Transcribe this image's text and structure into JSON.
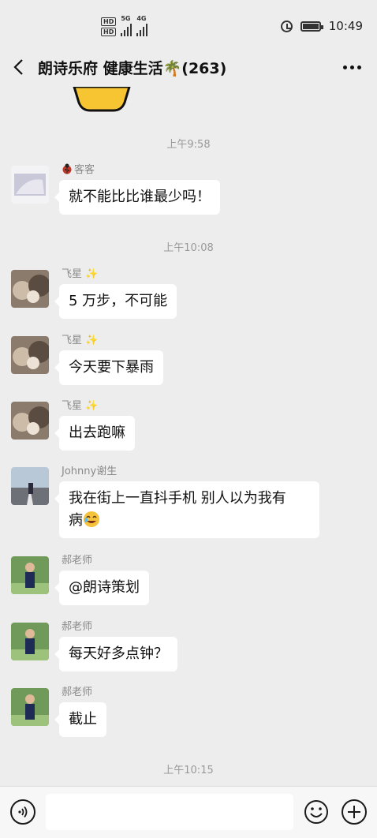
{
  "status_bar": {
    "hd1": "HD",
    "hd2": "HD",
    "net1": "5G",
    "net2": "4G",
    "time": "10:49"
  },
  "header": {
    "title": "朗诗乐府 健康生活🌴(263)"
  },
  "chat": {
    "timestamps": [
      "上午9:58",
      "上午10:08",
      "上午10:15"
    ],
    "messages": [
      {
        "sender": "客客",
        "text": "就不能比比谁最少吗！"
      },
      {
        "sender": "飞星",
        "text": "5 万步，不可能"
      },
      {
        "sender": "飞星",
        "text": "今天要下暴雨"
      },
      {
        "sender": "飞星",
        "text": "出去跑嘛"
      },
      {
        "sender": "Johnny谢生",
        "text_line1": "我在街上一直抖手机 别人以为我有",
        "text_line2": "病"
      },
      {
        "sender": "郝老师",
        "text": "@朗诗策划"
      },
      {
        "sender": "郝老师",
        "text": "每天好多点钟？"
      },
      {
        "sender": "郝老师",
        "text": "截止"
      }
    ]
  },
  "icons": {
    "back": "chevron-left-icon",
    "more": "more-dots-icon",
    "voice": "voice-icon",
    "emoji": "emoji-icon",
    "plus": "plus-icon"
  },
  "colors": {
    "background": "#ededed",
    "bubble": "#ffffff",
    "timestamp": "#999999",
    "sender": "#8a8a8a"
  }
}
